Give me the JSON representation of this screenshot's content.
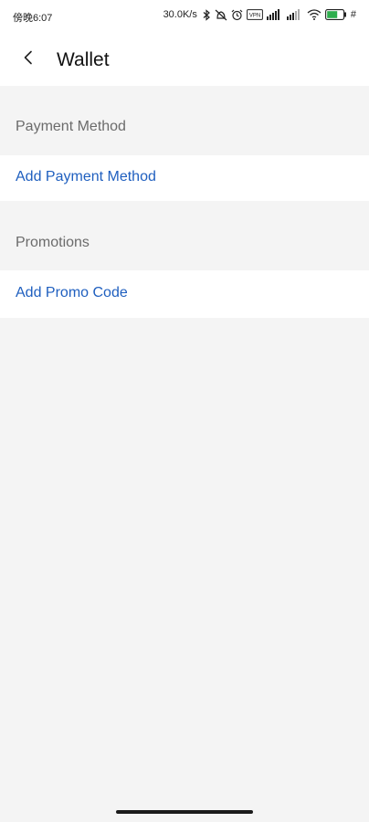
{
  "status_bar": {
    "time": "傍晚6:07",
    "network_speed": "30.0K/s",
    "icons": [
      "bluetooth-icon",
      "dnd-icon",
      "alarm-icon",
      "vpn-icon",
      "signal-icon",
      "signal-icon-2",
      "wifi-icon",
      "battery-icon",
      "charging-icon"
    ],
    "vpn_label": "VPN",
    "charging_symbol": "#"
  },
  "header": {
    "back_icon": "chevron-left-icon",
    "title": "Wallet"
  },
  "sections": {
    "payment": {
      "header": "Payment Method",
      "action": "Add Payment Method"
    },
    "promotions": {
      "header": "Promotions",
      "action": "Add Promo Code"
    }
  },
  "colors": {
    "link": "#1f5fbf",
    "section_header_text": "#6b6b6b",
    "background": "#f4f4f4"
  }
}
